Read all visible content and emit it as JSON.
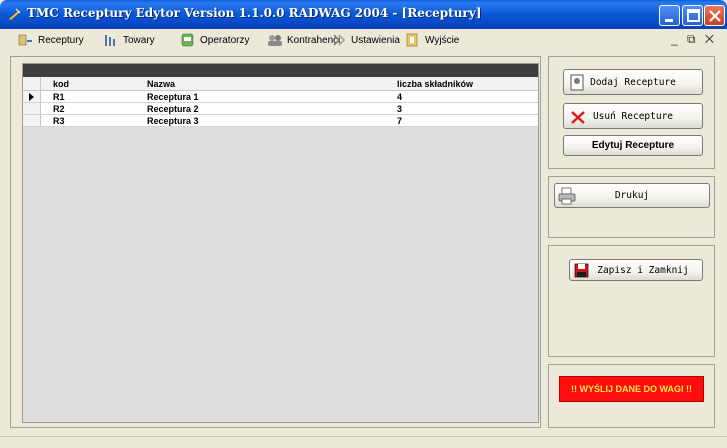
{
  "window": {
    "title": "TMC Receptury Edytor   Version 1.1.0.0   RADWAG 2004   - [Receptury]"
  },
  "menu": {
    "items": [
      {
        "label": "Receptury",
        "icon": "recipes-icon"
      },
      {
        "label": "Towary",
        "icon": "goods-icon"
      },
      {
        "label": "Operatorzy",
        "icon": "operators-icon"
      },
      {
        "label": "Kontrahenci",
        "icon": "contractors-icon"
      },
      {
        "label": "Ustawienia",
        "icon": "settings-icon"
      },
      {
        "label": "Wyjście",
        "icon": "exit-icon"
      }
    ],
    "mdi_controls": "_ ⧉ ✕"
  },
  "table": {
    "columns": [
      "kod",
      "Nazwa",
      "liczba składników"
    ],
    "rows": [
      {
        "kod": "R1",
        "nazwa": "Receptura 1",
        "liczba": "4"
      },
      {
        "kod": "R2",
        "nazwa": "Receptura 2",
        "liczba": "3"
      },
      {
        "kod": "R3",
        "nazwa": "Receptura 3",
        "liczba": "7"
      }
    ],
    "selected_row": 0
  },
  "buttons": {
    "dodaj": "Dodaj Recepture",
    "usun": "Usuń Recepture",
    "edytuj": "Edytuj Recepture",
    "drukuj": "Drukuj",
    "zapisz": "Zapisz i Zamknij",
    "wyslij": "!! WYŚLIJ DANE DO WAGI !!"
  },
  "colors": {
    "titlebar": "#0b58d6",
    "send_button_bg": "#ff0d0d",
    "send_button_text": "#ffe74a",
    "grid_header_bar": "#3e3e3e"
  }
}
